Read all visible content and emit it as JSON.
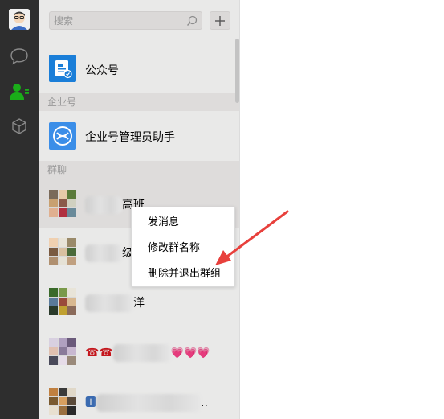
{
  "search": {
    "placeholder": "搜索"
  },
  "list": {
    "official": {
      "label": "公众号"
    },
    "sections": [
      {
        "title": "企业号"
      },
      {
        "title": "群聊"
      }
    ],
    "enterprise": {
      "label": "企业号管理员助手"
    },
    "groups": [
      {
        "suffix": "高班"
      },
      {
        "suffix": "级"
      },
      {
        "suffix": "洋"
      },
      {
        "prefix": "☎☎",
        "suffix": "💗💗💗"
      },
      {
        "prefix": "🅸",
        "suffix": ".."
      }
    ]
  },
  "context_menu": {
    "items": [
      "发消息",
      "修改群名称",
      "删除并退出群组"
    ]
  },
  "colors": {
    "accent": "#1aad19",
    "arrow": "#e8403c"
  }
}
